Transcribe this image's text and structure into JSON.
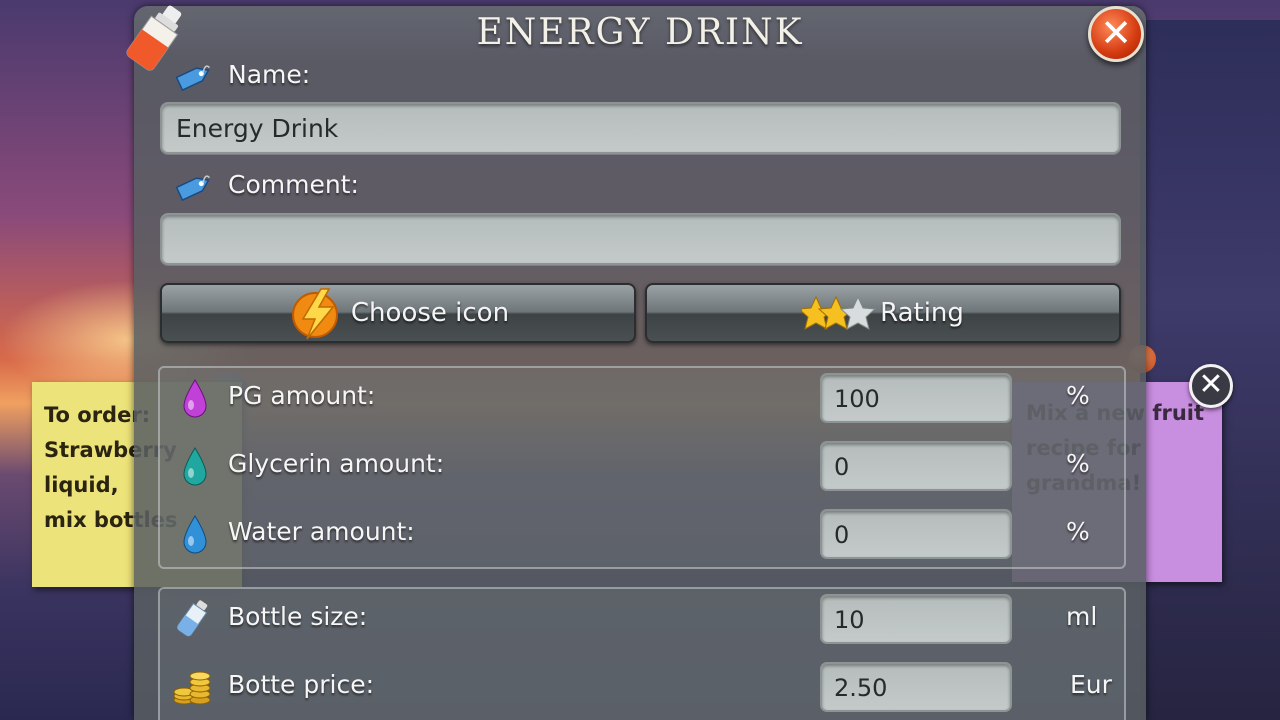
{
  "dialog": {
    "title": "ENERGY DRINK",
    "close_icon": "close-x-icon"
  },
  "name": {
    "label": "Name:",
    "value": "Energy Drink",
    "icon": "tag-icon"
  },
  "comment": {
    "label": "Comment:",
    "value": "",
    "icon": "tag-icon"
  },
  "buttons": {
    "choose_icon": "Choose icon",
    "rating": "Rating",
    "rating_stars": 2,
    "rating_max": 3
  },
  "liquids": [
    {
      "label": "PG amount:",
      "value": "100",
      "unit": "%",
      "icon": "purple-drop-icon",
      "color": "#c040d8"
    },
    {
      "label": "Glycerin amount:",
      "value": "0",
      "unit": "%",
      "icon": "teal-drop-icon",
      "color": "#20a8a0"
    },
    {
      "label": "Water amount:",
      "value": "0",
      "unit": "%",
      "icon": "blue-drop-icon",
      "color": "#3090d8"
    }
  ],
  "bottle": [
    {
      "label": "Bottle size:",
      "value": "10",
      "unit": "ml",
      "icon": "bottle-icon"
    },
    {
      "label": "Botte price:",
      "value": "2.50",
      "unit": "Eur",
      "icon": "coins-icon"
    }
  ],
  "notes": {
    "yellow": [
      "To order:",
      "Strawberry liquid,",
      "mix bottles"
    ],
    "pink": [
      "Mix a new fruit",
      "recipe for",
      "grandma!"
    ]
  }
}
